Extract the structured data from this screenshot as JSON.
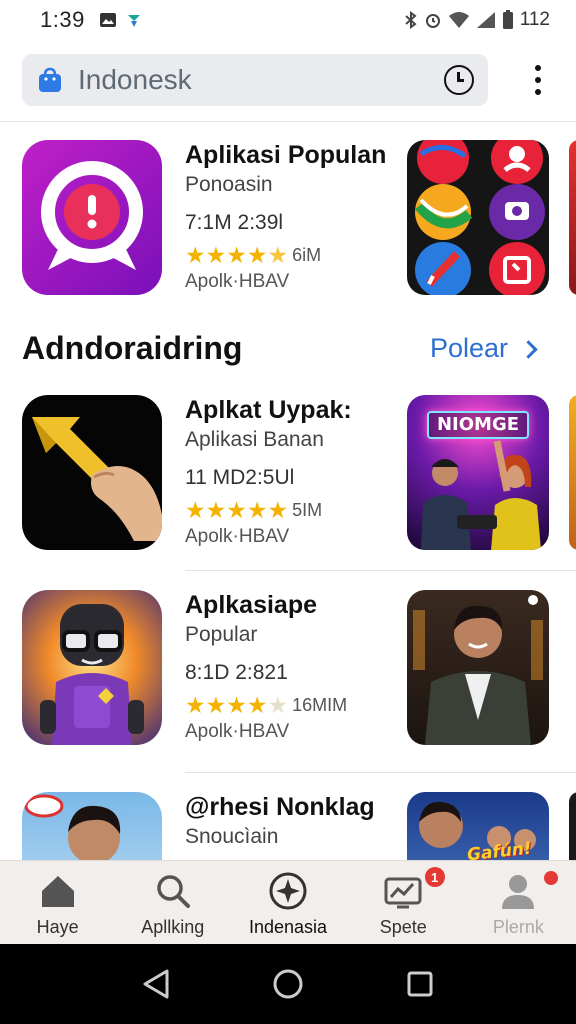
{
  "status": {
    "time": "1:39",
    "battery": "112"
  },
  "search": {
    "query": "Indonesk"
  },
  "apps_top": [
    {
      "title": "Aplikasi Populan",
      "subtitle": "Ponoasin",
      "meta": "7:1M 2:39l",
      "rating_stars": 4.5,
      "rating_count": "6iM",
      "developer": "Apolk·HBAV"
    }
  ],
  "section": {
    "title": "Adndoraidring",
    "link_label": "Polear"
  },
  "apps": [
    {
      "title": "Aplkat Uypak:",
      "subtitle": "Aplikasi Banan",
      "meta": "11 MD2:5Ul",
      "rating_stars": 5,
      "rating_count": "5IM",
      "developer": "Apolk·HBAV",
      "thumb_text": "NIOMGE"
    },
    {
      "title": "Aplkasiape",
      "subtitle": "Popular",
      "meta": "8:1D 2:821",
      "rating_stars": 4,
      "rating_count": "16MIM",
      "developer": "Apolk·HBAV"
    },
    {
      "title": "@rhesi Nonklag",
      "subtitle": "Snoucìain",
      "thumb_text": "Gafún!"
    }
  ],
  "bottom_nav": [
    {
      "label": "Haye",
      "icon": "home-icon"
    },
    {
      "label": "Apllking",
      "icon": "search-icon"
    },
    {
      "label": "Indenasia",
      "icon": "compass-icon"
    },
    {
      "label": "Spete",
      "icon": "chart-icon",
      "badge": "1"
    },
    {
      "label": "Plernk",
      "icon": "person-icon"
    }
  ],
  "colors": {
    "accent": "#2e6fd0",
    "star": "#f5b301",
    "badge": "#e53935"
  }
}
